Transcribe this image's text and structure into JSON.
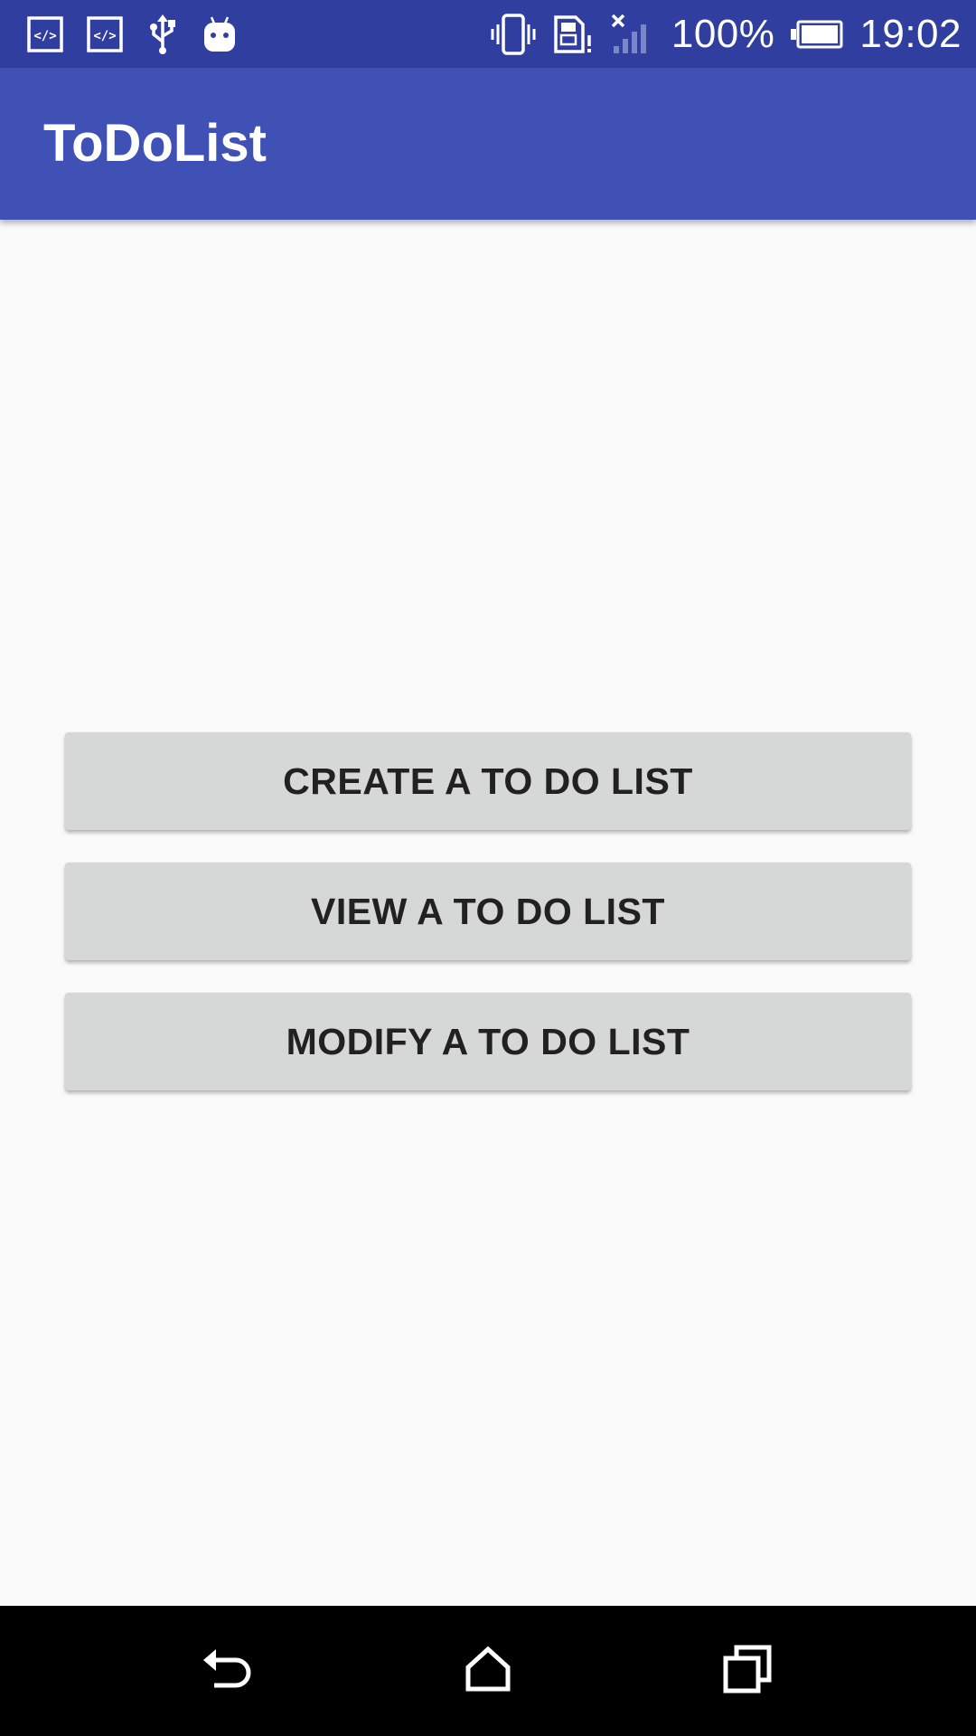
{
  "status_bar": {
    "battery_percent": "100%",
    "time": "19:02",
    "icons": [
      "code-icon",
      "code-icon",
      "usb-icon",
      "android-icon",
      "vibrate-icon",
      "sim-alert-icon",
      "signal-no-service-icon",
      "battery-icon"
    ]
  },
  "app_bar": {
    "title": "ToDoList"
  },
  "main": {
    "buttons": [
      {
        "label": "CREATE A TO DO LIST"
      },
      {
        "label": "VIEW A TO DO LIST"
      },
      {
        "label": "MODIFY A TO DO LIST"
      }
    ]
  },
  "nav_bar": {
    "icons": [
      "back-icon",
      "home-icon",
      "recents-icon"
    ]
  },
  "colors": {
    "status_bar": "#303f9f",
    "app_bar": "#3f51b5",
    "background": "#fafafa",
    "button": "#d6d7d7",
    "button_text": "#212121",
    "nav_bar": "#000000"
  }
}
